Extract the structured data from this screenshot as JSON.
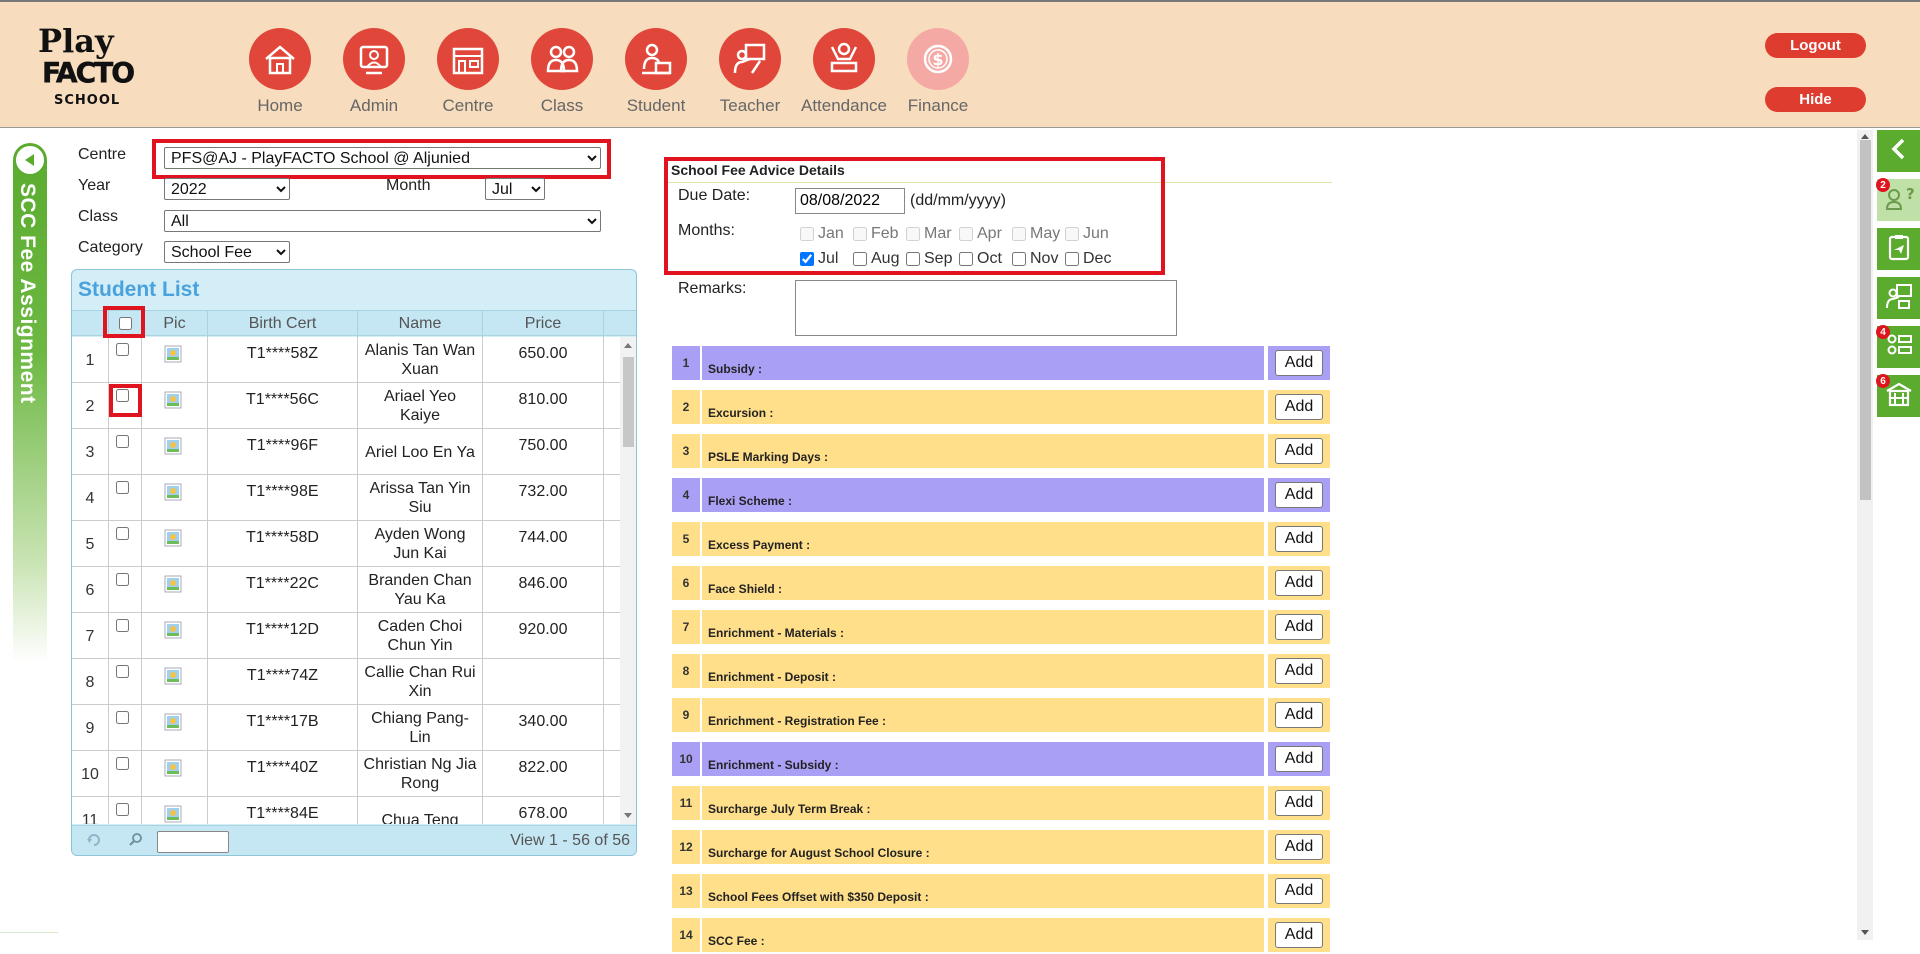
{
  "header": {
    "logo": {
      "line1": "Play",
      "line2": "FACTO",
      "line3": "SCHOOL"
    },
    "nav": [
      {
        "label": "Home",
        "icon": "home-icon"
      },
      {
        "label": "Admin",
        "icon": "admin-icon"
      },
      {
        "label": "Centre",
        "icon": "centre-icon"
      },
      {
        "label": "Class",
        "icon": "class-icon"
      },
      {
        "label": "Student",
        "icon": "student-icon"
      },
      {
        "label": "Teacher",
        "icon": "teacher-icon"
      },
      {
        "label": "Attendance",
        "icon": "attendance-icon"
      },
      {
        "label": "Finance",
        "icon": "finance-icon"
      }
    ],
    "logout_label": "Logout",
    "hide_label": "Hide",
    "accent": "#e0473a"
  },
  "side_tab": {
    "label": "SCC Fee Assignment"
  },
  "filters": {
    "centre_label": "Centre",
    "centre_value": "PFS@AJ - PlayFACTO School @ Aljunied",
    "year_label": "Year",
    "year_value": "2022",
    "month_label": "Month",
    "month_value": "Jul",
    "class_label": "Class",
    "class_value": "All",
    "category_label": "Category",
    "category_value": "School Fee"
  },
  "student_list": {
    "title": "Student List",
    "columns": {
      "pic": "Pic",
      "birth_cert": "Birth Cert",
      "name": "Name",
      "price": "Price"
    },
    "rows": [
      {
        "num": "1",
        "bc": "T1****58Z",
        "name": "Alanis Tan Wan Xuan",
        "price": "650.00",
        "checked": false
      },
      {
        "num": "2",
        "bc": "T1****56C",
        "name": "Ariael Yeo Kaiye",
        "price": "810.00",
        "checked": false
      },
      {
        "num": "3",
        "bc": "T1****96F",
        "name": "Ariel Loo En Ya",
        "price": "750.00",
        "checked": false
      },
      {
        "num": "4",
        "bc": "T1****98E",
        "name": "Arissa Tan Yin Siu",
        "price": "732.00",
        "checked": false
      },
      {
        "num": "5",
        "bc": "T1****58D",
        "name": "Ayden Wong Jun Kai",
        "price": "744.00",
        "checked": false
      },
      {
        "num": "6",
        "bc": "T1****22C",
        "name": "Branden Chan Yau Ka",
        "price": "846.00",
        "checked": false
      },
      {
        "num": "7",
        "bc": "T1****12D",
        "name": "Caden Choi Chun Yin",
        "price": "920.00",
        "checked": false
      },
      {
        "num": "8",
        "bc": "T1****74Z",
        "name": "Callie Chan Rui Xin",
        "price": "",
        "checked": false
      },
      {
        "num": "9",
        "bc": "T1****17B",
        "name": "Chiang Pang-Lin",
        "price": "340.00",
        "checked": false
      },
      {
        "num": "10",
        "bc": "T1****40Z",
        "name": "Christian Ng Jia Rong",
        "price": "822.00",
        "checked": false
      },
      {
        "num": "11",
        "bc": "T1****84E",
        "name": "Chua Teng",
        "price": "678.00",
        "checked": false
      }
    ],
    "pager_text": "View 1 - 56 of 56"
  },
  "fee_advice": {
    "title": "School Fee Advice Details",
    "due_date_label": "Due Date:",
    "due_date_value": "08/08/2022",
    "due_date_hint": "(dd/mm/yyyy)",
    "months_label": "Months:",
    "months": [
      {
        "name": "Jan",
        "checked": false,
        "disabled": true
      },
      {
        "name": "Feb",
        "checked": false,
        "disabled": true
      },
      {
        "name": "Mar",
        "checked": false,
        "disabled": true
      },
      {
        "name": "Apr",
        "checked": false,
        "disabled": true
      },
      {
        "name": "May",
        "checked": false,
        "disabled": true
      },
      {
        "name": "Jun",
        "checked": false,
        "disabled": true
      },
      {
        "name": "Jul",
        "checked": true,
        "disabled": false
      },
      {
        "name": "Aug",
        "checked": false,
        "disabled": false
      },
      {
        "name": "Sep",
        "checked": false,
        "disabled": false
      },
      {
        "name": "Oct",
        "checked": false,
        "disabled": false
      },
      {
        "name": "Nov",
        "checked": false,
        "disabled": false
      },
      {
        "name": "Dec",
        "checked": false,
        "disabled": false
      }
    ],
    "remarks_label": "Remarks:",
    "add_label": "Add",
    "items": [
      {
        "num": "1",
        "name": "Subsidy :",
        "color": "purple"
      },
      {
        "num": "2",
        "name": "Excursion :",
        "color": "yellow"
      },
      {
        "num": "3",
        "name": "PSLE Marking Days :",
        "color": "yellow"
      },
      {
        "num": "4",
        "name": "Flexi Scheme :",
        "color": "purple"
      },
      {
        "num": "5",
        "name": "Excess Payment :",
        "color": "yellow"
      },
      {
        "num": "6",
        "name": "Face Shield :",
        "color": "yellow"
      },
      {
        "num": "7",
        "name": "Enrichment - Materials :",
        "color": "yellow"
      },
      {
        "num": "8",
        "name": "Enrichment - Deposit :",
        "color": "yellow"
      },
      {
        "num": "9",
        "name": "Enrichment - Registration Fee :",
        "color": "yellow"
      },
      {
        "num": "10",
        "name": "Enrichment - Subsidy :",
        "color": "purple"
      },
      {
        "num": "11",
        "name": "Surcharge July Term Break :",
        "color": "yellow"
      },
      {
        "num": "12",
        "name": "Surcharge for August School Closure :",
        "color": "yellow"
      },
      {
        "num": "13",
        "name": "School Fees Offset with $350 Deposit :",
        "color": "yellow"
      },
      {
        "num": "14",
        "name": "SCC Fee :",
        "color": "yellow"
      }
    ],
    "colors": {
      "yellow": "#ffdf8a",
      "purple": "#a9a0f5"
    }
  },
  "right_toolbar": [
    {
      "icon": "collapse-arrow-icon",
      "badge": ""
    },
    {
      "icon": "help-user-icon",
      "badge": "2"
    },
    {
      "icon": "clipboard-plane-icon",
      "badge": ""
    },
    {
      "icon": "teacher-board-icon",
      "badge": ""
    },
    {
      "icon": "user-list-icon",
      "badge": "4"
    },
    {
      "icon": "school-building-icon",
      "badge": "6"
    }
  ]
}
